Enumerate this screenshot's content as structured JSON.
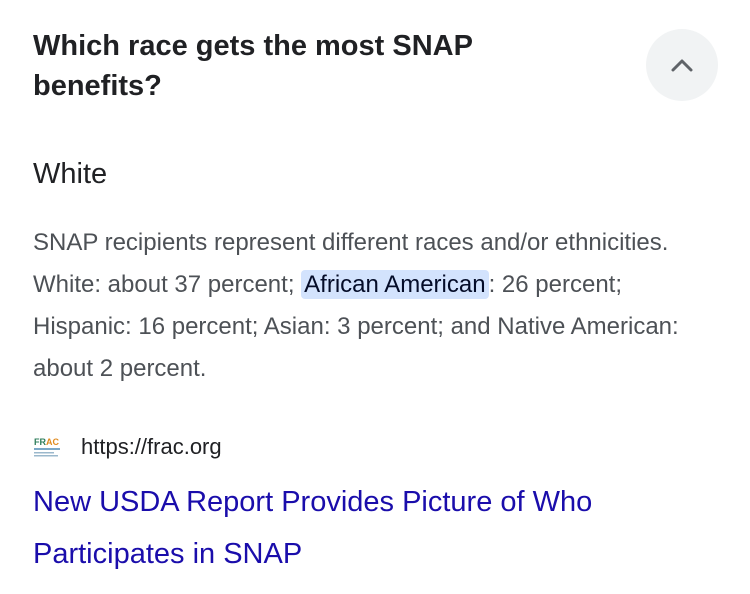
{
  "question": "Which race gets the most SNAP benefits?",
  "collapse_icon": "chevron-up-icon",
  "answer": "White",
  "snippet": {
    "before": "SNAP recipients represent different races and/or ethnicities. White: about 37 percent; ",
    "highlight": "African American",
    "after": ": 26 percent; Hispanic: 16 percent; Asian: 3 percent; and Native American: about 2 percent."
  },
  "source": {
    "favicon": "frac-logo-icon",
    "url": "https://frac.org"
  },
  "result": {
    "title": "New USDA Report Provides Picture of Who Participates in SNAP"
  },
  "colors": {
    "link": "#1a0dab",
    "highlight": "#d3e3fd",
    "button_bg": "#f1f3f4"
  }
}
